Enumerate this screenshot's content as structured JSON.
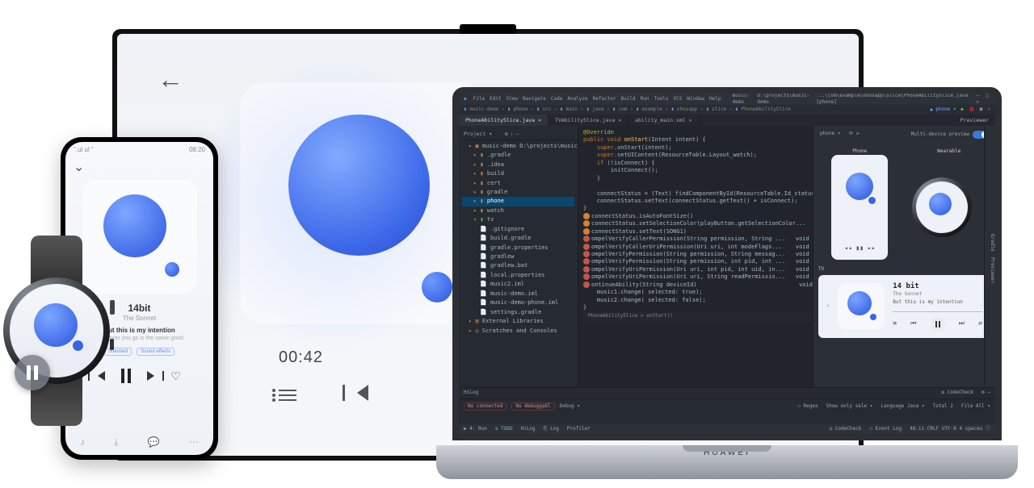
{
  "tv": {
    "time": "00:42"
  },
  "phone": {
    "status_left": "\".ul ul \"",
    "status_right": "08:20",
    "title": "14bit",
    "artist": "The Sonnet",
    "lyric1": "But this is my intention",
    "lyric2": "Wherever you go is the same good",
    "tag1": "Standard",
    "tag2": "Sound effects"
  },
  "laptop": {
    "brand": "HUAWEI"
  },
  "ide": {
    "menus": [
      "File",
      "Edit",
      "View",
      "Navigate",
      "Code",
      "Analyze",
      "Refactor",
      "Build",
      "Run",
      "Tools",
      "VCS",
      "Window",
      "Help"
    ],
    "title_project": "music-demo",
    "title_path": "D:\\projects\\music-demo",
    "title_file": "...\\com\\example\\ohosapp\\slice\\PhoneAbilitySlice.java [phone]",
    "crumbs": [
      "music-demo",
      "phone",
      "src",
      "main",
      "java",
      "com",
      "example",
      "ohosapp",
      "slice",
      "PhoneAbilitySlice"
    ],
    "tabs": {
      "t1": "PhoneAbilitySlice.java",
      "t2": "TVAbilitySlice.java",
      "t3": "ability_main.xml"
    },
    "run_config": "phone",
    "project": {
      "header": "Project ▾",
      "root": "music-demo  D:\\projects\\music",
      "n_gradle": ".gradle",
      "n_idea": ".idea",
      "n_build": "build",
      "n_cert": "cert",
      "n_gradle2": "gradle",
      "n_phone": "phone",
      "n_watch": "watch",
      "n_tv": "tv",
      "n_gitignore": ".gitignore",
      "n_buildgradle": "build.gradle",
      "n_gradleprops": "gradle.properties",
      "n_gradlew": "gradlew",
      "n_gradlewbat": "gradlew.bat",
      "n_localprops": "local.properties",
      "n_music2": "music2.iml",
      "n_musicdemo": "music-demo.iml",
      "n_musicdemophone": "music-demo-phone.iml",
      "n_settings": "settings.gradle",
      "n_extlib": "External Libraries",
      "n_scratch": "Scratches and Consoles"
    },
    "code": {
      "l1": "@Override",
      "l2a": "public void ",
      "l2b": "onStart",
      "l2c": "(Intent intent) {",
      "l3a": "    super",
      "l3b": ".onStart(intent);",
      "l4a": "    super",
      "l4b": ".setUIContent(ResourceTable.",
      "l4c": "Layout_watch",
      "l4d": ");",
      "l5a": "    if",
      "l5b": " (!isConnect) {",
      "l6": "        initConnect();",
      "l7": "    }",
      "l8": "",
      "l9": "    connectStatus = (Text) findComponentById(ResourceTable.Id_status);",
      "l10": "    connectStatus.setText(connectStatus.getText() + isConnect);",
      "l11": "}",
      "w1": "connectStatus.isAutoFontSize()                                    boolean",
      "w2": "connectStatus.setSelectionColor(playButton.getSelectionColor...",
      "w3": "connectStatus.setText(SONG1)",
      "e1": "ompelVerifyCallerPermission(String permission, String ...   void",
      "e2": "ompelVerifyCallerUriPermission(Uri uri, int modeFlags...    void",
      "e3": "ompelVerifyPermission(String permission, String messag...   void",
      "e4": "ompelVerifyPermission(String permission, int pid, int ...   void",
      "e5": "ompelVerifyUriPermission(Uri uri, int pid, int uid, in...   void",
      "e6": "ompelVerifyUriPermission(Uri uri, String readPermissio...   void",
      "e7": "ontinueAbility(String deviceId)                              void",
      "e8": "music1.change( selected: true);",
      "e9": "music2.change( selected: false);",
      "path": "PhoneAbilitySlice > onStart()"
    },
    "previewer": {
      "header": "Previewer",
      "toggle_label": "Multi-device preview",
      "phone_label": "Phone",
      "wearable_label": "Wearable",
      "tv_label": "TV",
      "tv_title": "14 bit",
      "tv_artist": "The Sonnet",
      "tv_lyric": "But this is my intention"
    },
    "bottom": {
      "tab_hilog": "HiLog",
      "tab_codecheck": "CodeCheck",
      "chip1": "No connected",
      "chip2": "No debuggabl",
      "opt_debug": "Debug ▾",
      "opt_regex": "Regex",
      "opt_show": "Show only sele ▾",
      "opt_lang": "Language  Java ▾",
      "opt_total": "Total  2",
      "opt_file": "File  All ▾"
    },
    "statusbar": {
      "s1": "▶ 4: Run",
      "s2": "≡ TODO",
      "s3": "HiLog",
      "s4": "⎘ Log",
      "s5": "Profiler",
      "r1": "◷ CodeCheck",
      "r2": "☐ Event Log",
      "r3": "48:11  CRLF  UTF-8  4 spaces  ⓘ"
    },
    "side_gradle": "Gradle",
    "side_previewer": "Previewer"
  }
}
